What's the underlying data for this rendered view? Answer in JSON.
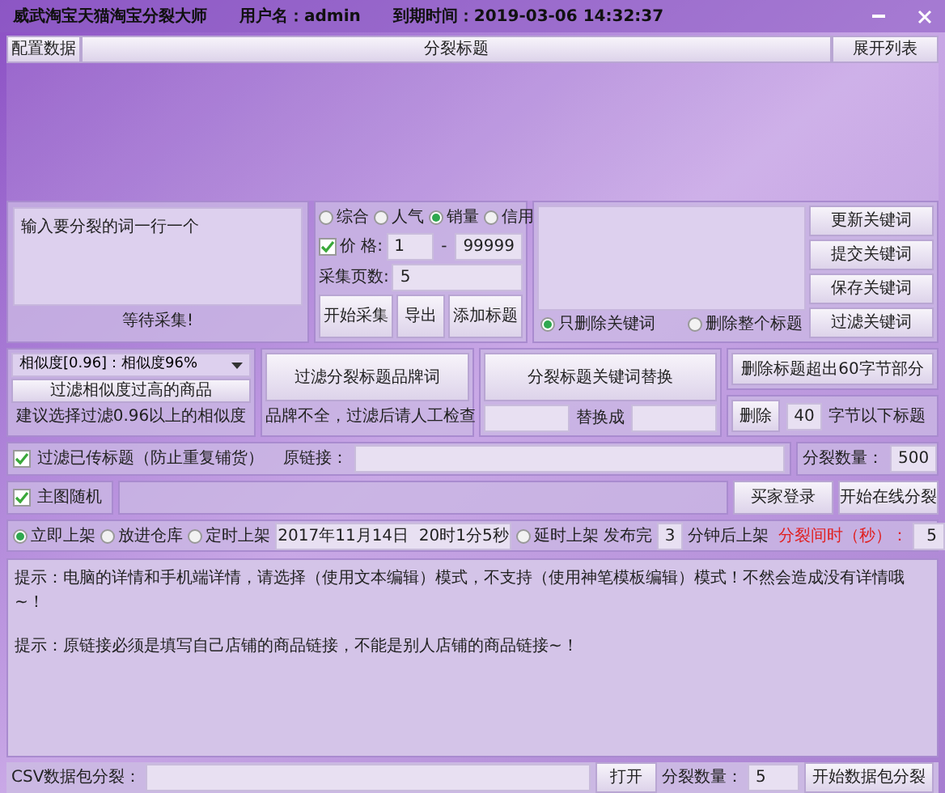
{
  "window": {
    "title": "威武淘宝天猫淘宝分裂大师",
    "user": "用户名：admin",
    "expiry": "到期时间：2019-03-06 14:32:37"
  },
  "toolbar": {
    "left_button": "配置数据",
    "center_button": "分裂标题",
    "right_button": "展开列表"
  },
  "keywords_input": {
    "placeholder": "输入要分裂的词一行一个",
    "status": "等待采集!"
  },
  "sort_options": [
    {
      "label": "综合",
      "selected": false
    },
    {
      "label": "人气",
      "selected": false
    },
    {
      "label": "销量",
      "selected": true
    },
    {
      "label": "信用",
      "selected": false
    }
  ],
  "price": {
    "label": "价 格:",
    "checked": true,
    "min": "1",
    "dash": "-",
    "max": "99999"
  },
  "pages": {
    "label": "采集页数:",
    "value": "5"
  },
  "collect_buttons": [
    "开始采集",
    "导出",
    "添加标题"
  ],
  "keyword_actions": [
    "更新关键词",
    "提交关键词",
    "保存关键词",
    "过滤关键词"
  ],
  "delete_modes": [
    {
      "label": "只删除关键词",
      "selected": true
    },
    {
      "label": "删除整个标题",
      "selected": false
    }
  ],
  "similarity": {
    "dropdown": "相似度[0.96]：相似度96%",
    "button": "过滤相似度过高的商品",
    "hint": "建议选择过滤0.96以上的相似度"
  },
  "brand": {
    "button": "过滤分裂标题品牌词",
    "hint": "品牌不全，过滤后请人工检查"
  },
  "replace": {
    "button": "分裂标题关键词替换",
    "label": "替换成"
  },
  "length": {
    "button": "删除标题超出60字节部分",
    "delete_button": "删除",
    "value": "40",
    "label": "字节以下标题"
  },
  "filter_sold": {
    "label": "过滤已传标题（防止重复铺货）",
    "checked": true,
    "link_label": "原链接：",
    "count_label": "分裂数量：",
    "count": "500"
  },
  "main_image": {
    "label": "主图随机",
    "checked": true,
    "buttons": [
      "买家登录",
      "开始在线分裂"
    ]
  },
  "listing": {
    "options": [
      {
        "label": "立即上架",
        "selected": true
      },
      {
        "label": "放进仓库",
        "selected": false
      },
      {
        "label": "定时上架",
        "selected": false
      }
    ],
    "datetime": "2017年11月14日  20时1分5秒",
    "delay": {
      "label": "延时上架",
      "selected": false
    },
    "after_label": "发布完",
    "minutes": "3",
    "minutes_label": "分钟后上架",
    "interval_label": "分裂间时（秒）：",
    "interval": "5"
  },
  "tips": [
    "提示：电脑的详情和手机端详情，请选择（使用文本编辑）模式，不支持（使用神笔模板编辑）模式！不然会造成没有详情哦~！",
    "提示：原链接必须是填写自己店铺的商品链接，不能是别人店铺的商品链接~！"
  ],
  "csv": {
    "label": "CSV数据包分裂：",
    "open": "打开",
    "count_label": "分裂数量：",
    "count": "5",
    "start": "开始数据包分裂"
  }
}
